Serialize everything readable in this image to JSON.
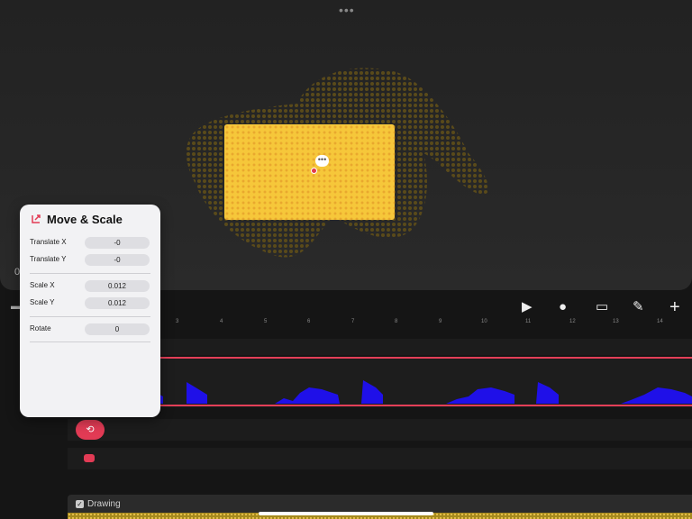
{
  "canvas": {
    "more_dots": "•••",
    "rect_menu": "•••",
    "left_number": "0",
    "rect_color": "#f6c73a",
    "accent": "#e23b55"
  },
  "toolbar": {
    "items": [
      {
        "icon": "play-icon",
        "glyph": "▶"
      },
      {
        "icon": "record-icon",
        "glyph": "●"
      },
      {
        "icon": "layers-icon",
        "glyph": "▭"
      },
      {
        "icon": "pen-icon",
        "glyph": "✎"
      },
      {
        "icon": "add-icon",
        "glyph": "+"
      }
    ]
  },
  "ruler": {
    "ticks": [
      "3",
      "4",
      "5",
      "6",
      "7",
      "8",
      "9",
      "10",
      "11",
      "12",
      "13",
      "14"
    ]
  },
  "timeline": {
    "move_keyframe_icon": "⟲",
    "drawing_label": "Drawing",
    "drawing_checkbox": "✓"
  },
  "popover": {
    "title": "Move & Scale",
    "rows": [
      {
        "label": "Translate X",
        "value": "-0"
      },
      {
        "label": "Translate Y",
        "value": "-0"
      },
      {
        "label": "Scale X",
        "value": "0.012"
      },
      {
        "label": "Scale Y",
        "value": "0.012"
      },
      {
        "label": "Rotate",
        "value": "0"
      }
    ]
  }
}
